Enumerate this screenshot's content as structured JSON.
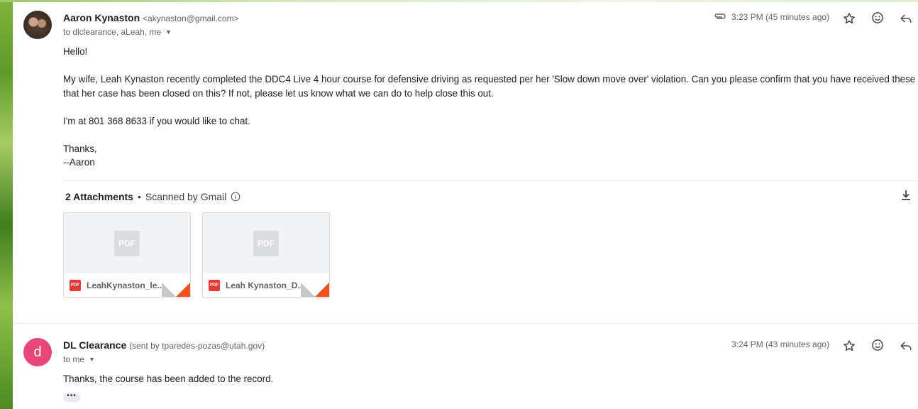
{
  "messages": [
    {
      "sender": "Aaron Kynaston",
      "email": "<akynaston@gmail.com>",
      "to": "to dlclearance, aLeah, me",
      "time": "3:23 PM (45 minutes ago)",
      "body": {
        "greeting": "Hello!",
        "p1_line1": "My wife, Leah Kynaston recently completed the DDC4 Live 4 hour course for defensive driving as requested per her 'Slow down move over' violation.  Can you please confirm that you have received these files, a",
        "p1_line2": "that her case has been closed on this? If not, please let us know what we can do to help close this out.",
        "p2": "I'm at 801 368 8633 if you would like to chat.",
        "thanks": "Thanks,",
        "signature": "--Aaron"
      },
      "attachments": {
        "count_label": "2 Attachments",
        "dot": "•",
        "scanned_label": "Scanned by Gmail",
        "files": [
          {
            "name": "LeahKynaston_le...",
            "type": "PDF"
          },
          {
            "name": "Leah Kynaston_D...",
            "type": "PDF"
          }
        ]
      }
    },
    {
      "sender": "DL Clearance",
      "sent_by": "(sent by tparedes-pozas@utah.gov)",
      "avatar_letter": "d",
      "to": "to me",
      "time": "3:24 PM (43 minutes ago)",
      "body": "Thanks, the course has been added to the record.",
      "trimmed": "•••"
    }
  ],
  "colors": {
    "avatar_d": "#e8477a",
    "pdf_red": "#e53935",
    "corner_orange": "#f4511e"
  },
  "icons": [
    "paperclip-icon",
    "star-icon",
    "emoji-icon",
    "reply-icon",
    "info-icon",
    "download-icon",
    "pdf-icon",
    "caret-down-icon"
  ]
}
